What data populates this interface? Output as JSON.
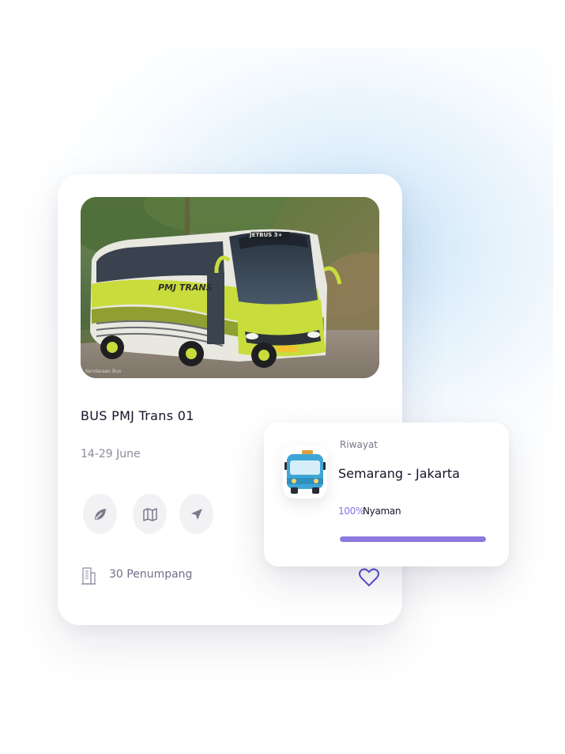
{
  "card": {
    "photo_watermark": "Kendaraan Bus",
    "bus_livery": "PMJ TRANS",
    "bus_header": "JETBUS 3+",
    "title": "BUS PMJ Trans 01",
    "dates": "14-29 June",
    "actions": [
      {
        "icon": "leaf-icon"
      },
      {
        "icon": "map-icon"
      },
      {
        "icon": "navigation-arrow-icon"
      }
    ],
    "passengers_icon": "building-icon",
    "passengers": "30 Penumpang",
    "favorite_icon": "heart-icon"
  },
  "history_panel": {
    "label": "Riwayat",
    "bus_icon": "bus-icon",
    "route": "Semarang - Jakarta",
    "comfort_percent_text": "100%",
    "comfort_label": "Nyaman",
    "comfort_progress": 1.0
  },
  "colors": {
    "accent": "#8c79dc",
    "percent_text": "#8b6fe6",
    "bus_icon_blue": "#3ea6d6",
    "bus_livery_green": "#c8dc3c"
  }
}
